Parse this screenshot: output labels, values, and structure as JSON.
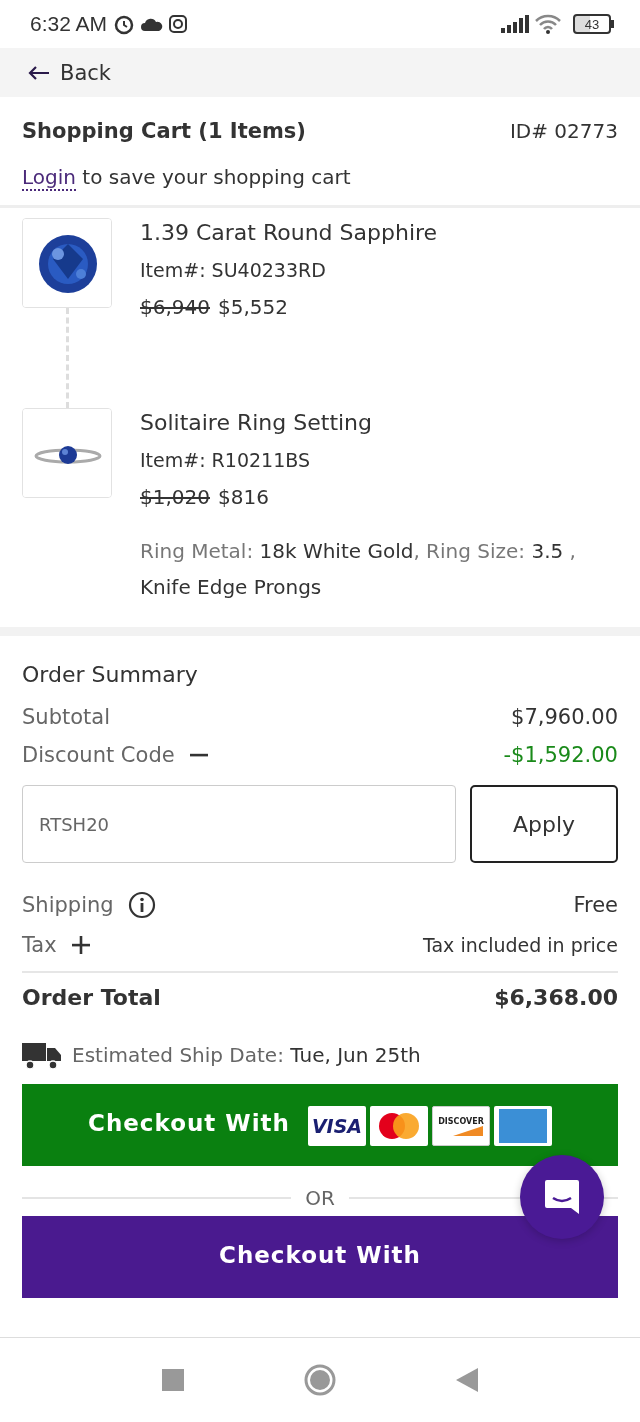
{
  "status_bar": {
    "time": "6:32 AM",
    "battery": "43"
  },
  "back": {
    "label": "Back"
  },
  "header": {
    "title": "Shopping Cart (1 Items)",
    "cart_id": "ID# 02773",
    "login_link": "Login",
    "login_text": "to save your shopping cart"
  },
  "items": [
    {
      "kind": "gem",
      "name": "1.39 Carat Round Sapphire",
      "item_no": "Item#: SU40233RD",
      "old_price": "$6,940",
      "price": "$5,552"
    },
    {
      "kind": "ring",
      "name": "Solitaire Ring Setting",
      "item_no": "Item#: R10211BS",
      "old_price": "$1,020",
      "price": "$816"
    }
  ],
  "options": "Ring Metal: **18k White Gold**, Ring Size: **3.5** , **Knife Edge Prongs**",
  "summary": {
    "title": "Order Summary",
    "subtotal_label": "Subtotal",
    "subtotal": "$7,960.00",
    "discount_label": "Discount Code",
    "discount_expanded": true,
    "discount": "-$1,592.00",
    "code_value": "RTSH20",
    "apply": "Apply",
    "shipping_label": "Shipping",
    "shipping": "Free",
    "tax_label": "Tax",
    "tax_expanded": false,
    "tax": "Tax included in price",
    "total_label": "Order Total",
    "total": "$6,368.00",
    "ship_label": "Estimated Ship Date:",
    "ship_date": "Tue, Jun 25th"
  },
  "checkout_card": {
    "label": "Checkout With",
    "cards": [
      {
        "kind": "visa",
        "text": "VISA"
      },
      {
        "kind": "mastercard"
      },
      {
        "kind": "discover",
        "text": "DISCOVER"
      },
      {
        "kind": "amex"
      }
    ]
  },
  "or": "OR",
  "checkout_alt": {
    "label": "Checkout With"
  }
}
